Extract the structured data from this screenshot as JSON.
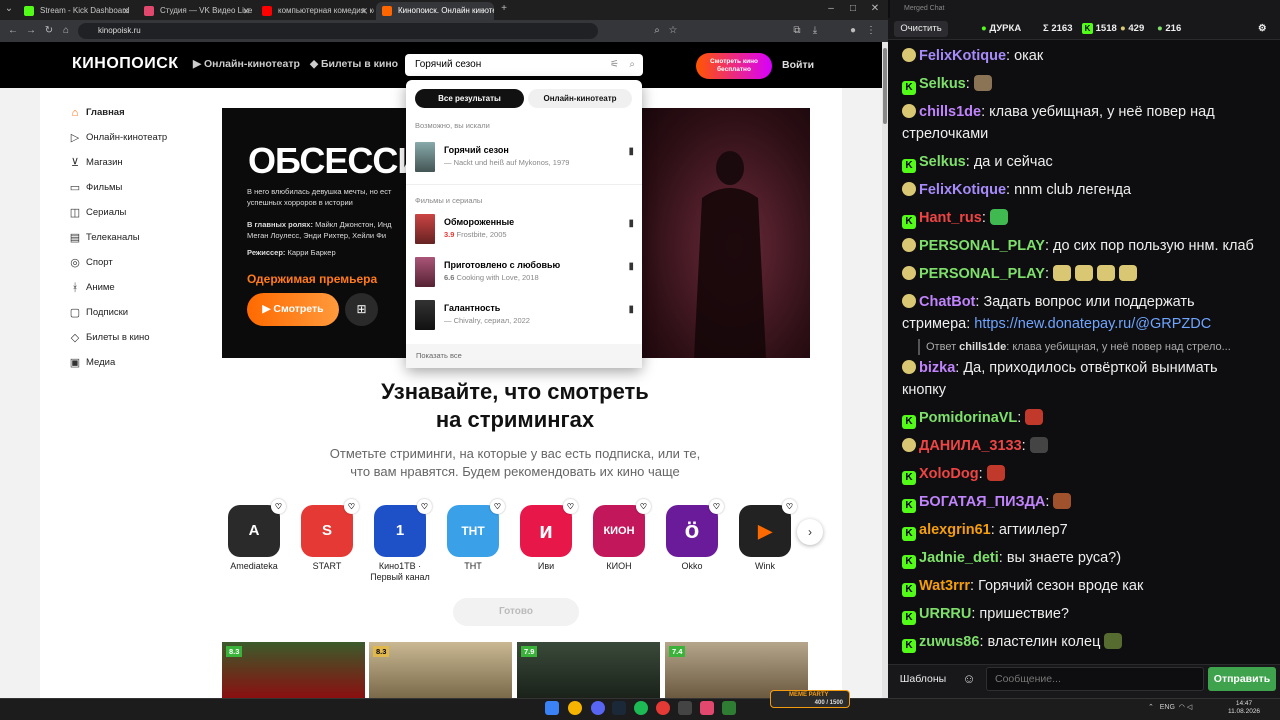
{
  "browser": {
    "tabs": [
      {
        "label": "Stream - Kick Dashboard",
        "color": "#53fc18"
      },
      {
        "label": "Студия — VK Видео Live",
        "color": "#e2486e"
      },
      {
        "label": "компьютерная комедия, когд",
        "color": "#ff0000"
      },
      {
        "label": "Кинопоиск. Онлайн кинотеатр",
        "color": "#ff6600"
      }
    ],
    "url": "kinopoisk.ru"
  },
  "kp": {
    "logo": "КИНОПОИСК",
    "nav": [
      "Онлайн-кинотеатр",
      "Билеты в кино"
    ],
    "search_value": "Горячий сезон",
    "promo": "Смотреть кино бесплатно",
    "login": "Войти",
    "sidebar": [
      "Главная",
      "Онлайн-кинотеатр",
      "Магазин",
      "Фильмы",
      "Сериалы",
      "Телеканалы",
      "Спорт",
      "Аниме",
      "Подписки",
      "Билеты в кино",
      "Медиа"
    ],
    "hero": {
      "title": "ОБСЕССИЯ",
      "desc1": "В него влюбилась девушка мечты, но ест",
      "desc2": "успешных хорроров в истории",
      "cast_label": "В главных ролях:",
      "cast1": "Майкл Джонстон, Инд",
      "cast2": "Меган Лоулесс, Энди Рихтер, Хейли Фи",
      "director_label": "Режиссер:",
      "director": "Карри Баркер",
      "subtitle": "Одержимая премьера",
      "watch": "Смотреть"
    },
    "dropdown": {
      "tab_all": "Все результаты",
      "tab_online": "Онлайн-кинотеатр",
      "maybe": "Возможно, вы искали",
      "films": "Фильмы и сериалы",
      "show_all": "Показать все",
      "top": {
        "title": "Горячий сезон",
        "sub": "— Nackt und heiß auf Mykonos, 1979"
      },
      "items": [
        {
          "title": "Обмороженные",
          "rating": "3.9",
          "sub": "Frostbite, 2005"
        },
        {
          "title": "Приготовлено с любовью",
          "rating": "6.6",
          "sub": "Cooking with Love, 2018"
        },
        {
          "title": "Галантность",
          "rating": "",
          "sub": "— Chivalry, сериал, 2022"
        }
      ]
    },
    "stream_title_1": "Узнавайте, что смотреть",
    "stream_title_2": "на стримингах",
    "stream_sub_1": "Отметьте стриминги, на которые у вас есть подписка, или те,",
    "stream_sub_2": "что вам нравятся. Будем рекомендовать их кино чаще",
    "services": [
      {
        "name": "Amediateka",
        "glyph": "A",
        "color": "#2a2a2a"
      },
      {
        "name": "START",
        "glyph": "S",
        "color": "#e53935"
      },
      {
        "name": "Кино1ТВ ·",
        "name2": "Первый канал",
        "glyph": "1",
        "color": "#1e50c8"
      },
      {
        "name": "ТНТ",
        "glyph": "ТНТ",
        "color": "#3aa0e8"
      },
      {
        "name": "Иви",
        "glyph": "и",
        "color": "#e8174a"
      },
      {
        "name": "КИОН",
        "glyph": "КИОН",
        "color": "#c2185b"
      },
      {
        "name": "Okko",
        "glyph": "ö",
        "color": "#6a1b9a"
      },
      {
        "name": "Wink",
        "glyph": "▶",
        "color": "#222222"
      }
    ],
    "done": "Готово",
    "ratings": [
      "8.3",
      "8.3",
      "7.9",
      "7.4"
    ]
  },
  "chat": {
    "window_title": "Merged Chat",
    "clear": "Очистить",
    "stats": {
      "name": "ДУРКА",
      "sigma": "Σ 2163",
      "kick": "1518",
      "p": "429",
      "v": "216"
    },
    "messages": [
      {
        "b": "p",
        "user": "FelixKotique",
        "color": "#a78bfa",
        "text": "окак"
      },
      {
        "b": "k",
        "user": "Selkus",
        "color": "#7ee06a",
        "text": ""
      },
      {
        "b": "p",
        "user": "chills1de",
        "color": "#c084fc",
        "text": "клава уебищная, у неё повер над"
      },
      {
        "cont": "стрелочками"
      },
      {
        "b": "k",
        "user": "Selkus",
        "color": "#7ee06a",
        "text": "да и сейчас"
      },
      {
        "b": "p",
        "user": "FelixKotique",
        "color": "#a78bfa",
        "text": "nnm club легенда"
      },
      {
        "b": "k",
        "user": "Hant_rus",
        "color": "#ef4444",
        "text": ""
      },
      {
        "b": "p",
        "user": "PERSONAL_PLAY",
        "color": "#7ee06a",
        "text": "до сих пор пользую ннм. клаб"
      },
      {
        "b": "p",
        "user": "PERSONAL_PLAY",
        "color": "#7ee06a",
        "text": ""
      },
      {
        "b": "p",
        "user": "ChatBot",
        "color": "#c084fc",
        "text": "Задать вопрос или поддержать"
      },
      {
        "cont": "стримера:",
        "link": "https://new.donatepay.ru/@GRPZDC"
      },
      {
        "b": "p",
        "user": "bizka",
        "color": "#c084fc",
        "text": "Да, приходилось отвёрткой вынимать"
      },
      {
        "cont": "кнопку"
      },
      {
        "b": "k",
        "user": "PomidorinaVL",
        "color": "#7ee06a",
        "text": ""
      },
      {
        "b": "p",
        "user": "ДАНИЛА_3133",
        "color": "#ef4444",
        "text": ""
      },
      {
        "b": "k",
        "user": "XoloDog",
        "color": "#ef4444",
        "text": ""
      },
      {
        "b": "k",
        "user": "БОГАТАЯ_ПИЗДА",
        "color": "#c084fc",
        "text": ""
      },
      {
        "b": "k",
        "user": "alexgrin61",
        "color": "#f59e0b",
        "text": "агтиилер7"
      },
      {
        "b": "k",
        "user": "Jadnie_deti",
        "color": "#7ee06a",
        "text": "вы знаете руса?)"
      },
      {
        "b": "k",
        "user": "Wat3rrr",
        "color": "#f59e0b",
        "text": "Горячий сезон вроде как"
      },
      {
        "b": "k",
        "user": "URRRU",
        "color": "#7ee06a",
        "text": "пришествие?"
      },
      {
        "b": "k",
        "user": "zuwus86",
        "color": "#7ee06a",
        "text": "властелин колец"
      }
    ],
    "reply": {
      "label": "Ответ",
      "user": "chills1de",
      "text": ": клава уебищная, у неё повер над стрело..."
    },
    "templates": "Шаблоны",
    "placeholder": "Сообщение...",
    "send": "Отправить"
  },
  "taskbar": {
    "lang": "ENG",
    "time": "14:47",
    "date": "11.08.2026",
    "meme": "MEME PARTY",
    "meme_count": "400 / 1500"
  }
}
